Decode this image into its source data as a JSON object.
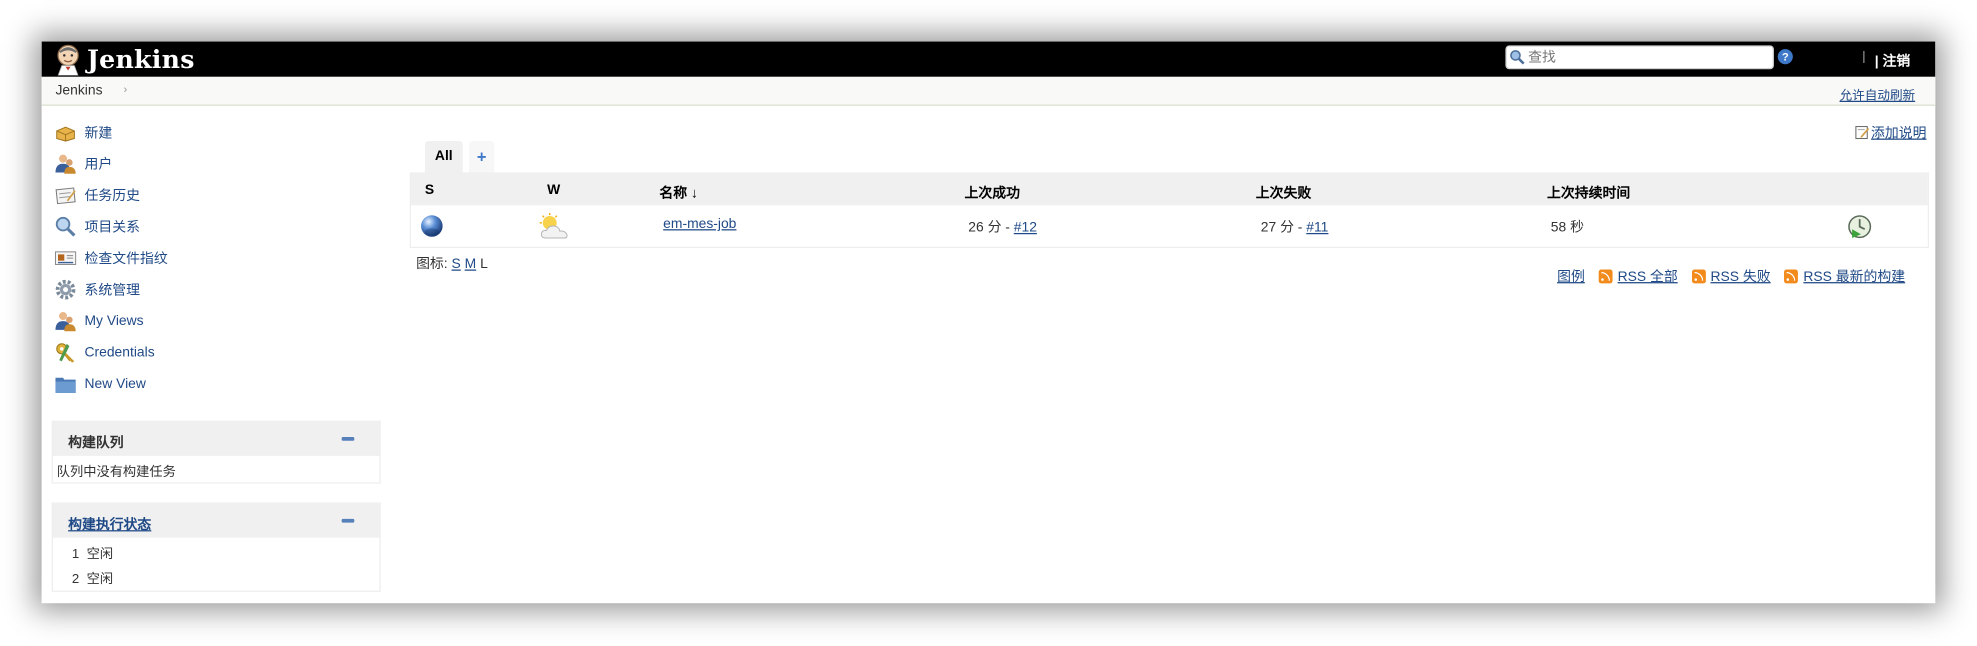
{
  "header": {
    "brand": "Jenkins",
    "search_placeholder": "查找",
    "separator": "|",
    "logout_label": "| 注销"
  },
  "breadcrumb": {
    "root": "Jenkins",
    "auto_refresh": "允许自动刷新"
  },
  "sidebar": {
    "tasks": [
      {
        "label": "新建",
        "icon": "new-item-icon"
      },
      {
        "label": "用户",
        "icon": "people-icon"
      },
      {
        "label": "任务历史",
        "icon": "build-history-icon"
      },
      {
        "label": "项目关系",
        "icon": "search-icon"
      },
      {
        "label": "检查文件指纹",
        "icon": "fingerprint-icon"
      },
      {
        "label": "系统管理",
        "icon": "gear-icon"
      },
      {
        "label": "My Views",
        "icon": "user-views-icon"
      },
      {
        "label": "Credentials",
        "icon": "credentials-icon"
      },
      {
        "label": "New View",
        "icon": "folder-icon"
      }
    ],
    "build_queue": {
      "title": "构建队列",
      "empty_text": "队列中没有构建任务"
    },
    "executors": {
      "title": "构建执行状态",
      "rows": [
        {
          "num": "1",
          "status": "空闲"
        },
        {
          "num": "2",
          "status": "空闲"
        }
      ]
    }
  },
  "main": {
    "add_description": "添加说明",
    "tabs": [
      {
        "label": "All"
      },
      {
        "label": "+"
      }
    ],
    "table": {
      "headers": [
        "S",
        "W",
        "名称 ↓",
        "上次成功",
        "上次失败",
        "上次持续时间"
      ],
      "rows": [
        {
          "name": "em-mes-job",
          "last_success_time": "26 分 - ",
          "last_success_build": "#12",
          "last_failure_time": "27 分 - ",
          "last_failure_build": "#11",
          "duration": "58 秒"
        }
      ]
    },
    "icon_size": {
      "label": "图标: ",
      "sizes": [
        "S",
        "M",
        "L"
      ]
    },
    "links": {
      "legend": "图例",
      "rss_all": "RSS 全部",
      "rss_failed": "RSS 失败",
      "rss_latest": "RSS 最新的构建"
    }
  },
  "colors": {
    "header_bg": "#000000",
    "link": "#204a87",
    "rss": "#f28a1c"
  }
}
